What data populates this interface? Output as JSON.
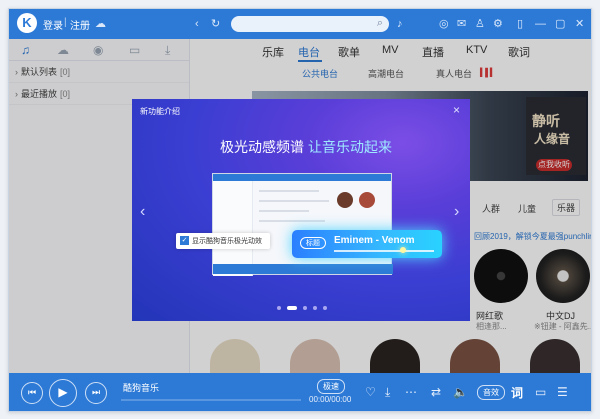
{
  "titlebar": {
    "logo": "K",
    "login": "登录",
    "separator": "|",
    "register": "注册",
    "search_placeholder": "",
    "icons": [
      "cloud-warning-icon",
      "back-icon",
      "refresh-icon",
      "mic-icon",
      "settings-icon",
      "mail-icon",
      "skin-icon",
      "gear-icon",
      "mobile-icon",
      "minimize-icon",
      "restore-icon",
      "close-icon"
    ]
  },
  "sidebar": {
    "tabs": [
      "music-note-icon",
      "cloud-icon",
      "radio-icon",
      "device-icon",
      "download-icon"
    ],
    "rows": [
      {
        "label": "默认列表",
        "count": "[0]"
      },
      {
        "label": "最近播放",
        "count": "[0]"
      }
    ]
  },
  "nav": {
    "items": [
      "乐库",
      "电台",
      "歌单",
      "MV",
      "直播",
      "KTV",
      "歌词"
    ],
    "active": "电台",
    "sub": [
      "公共电台",
      "高潮电台",
      "真人电台"
    ],
    "sub_active": "公共电台"
  },
  "background": {
    "banner_text1": "静听",
    "banner_text2": "人缘音",
    "banner_btn": "点我收听",
    "categories": [
      "人群",
      "儿童",
      "乐器"
    ],
    "link_text": "回顾2019，解锁今夏最强punchline",
    "cards": [
      {
        "title": "网红歌",
        "sub": "相逢那..."
      },
      {
        "title": "中文DJ",
        "sub": "※钮建 - 阿鑫先..."
      }
    ]
  },
  "modal": {
    "title": "新功能介绍",
    "close": "×",
    "headline1": "极光动感频谱",
    "headline2": "让音乐动起来",
    "checkbox_label": "显示酷狗音乐极光动效",
    "glow_tag": "标题",
    "glow_song": "Eminem - Venom",
    "prev": "‹",
    "next": "›"
  },
  "player": {
    "song": "酷狗音乐",
    "time": "00:00/00:00",
    "quality": "极速",
    "fx": "音效",
    "lyrics": "词"
  },
  "colors": {
    "accent": "#2d7ad6",
    "highlight": "#9ee8ff"
  }
}
